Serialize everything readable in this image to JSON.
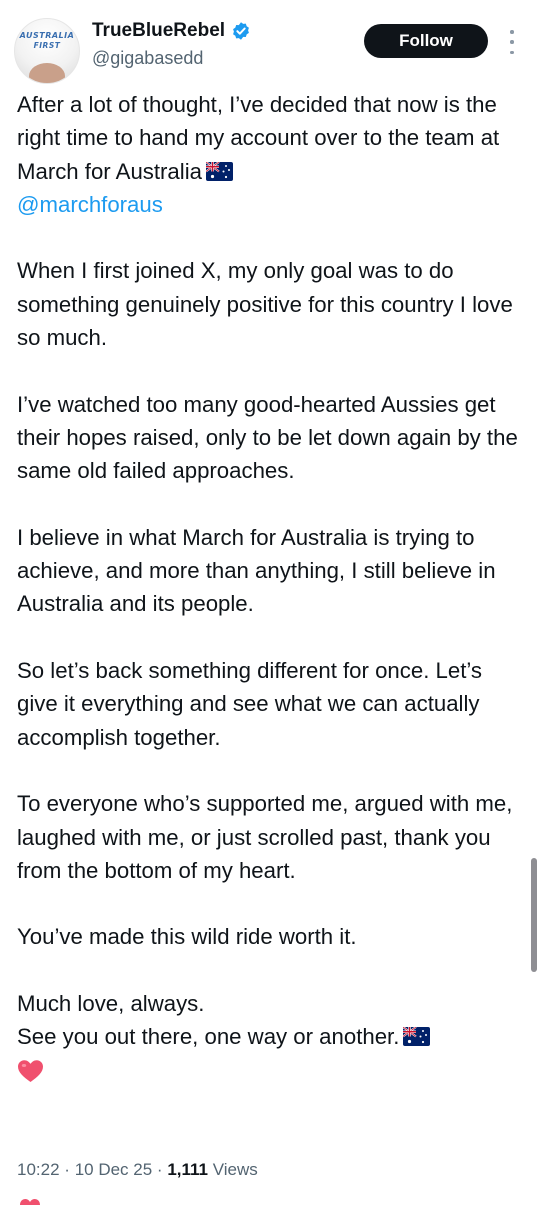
{
  "post": {
    "author": {
      "display_name": "TrueBlueRebel",
      "handle": "@gigabasedd",
      "avatar_cap_text": [
        "AUSTRALIA",
        "FIRST"
      ],
      "verified": true
    },
    "follow_label": "Follow",
    "mention": "@marchforaus",
    "paragraphs": {
      "p1": "After a lot of thought, I’ve decided that now is the right time to hand my account over to the team at March for Australia",
      "p2": "When I first joined X, my only goal was to do something genuinely positive for this country I love so much.",
      "p3": "I’ve watched too many good-hearted Aussies get their hopes raised, only to be let down again by the same old failed approaches.",
      "p4": "I believe in what March for Australia is trying to achieve, and more than anything, I still believe in Australia and its people.",
      "p5": "So let’s back something different for once. Let’s give it everything and see what we can actually accomplish together.",
      "p6": "To everyone who’s supported me, argued with me, laughed with me, or just scrolled past, thank you from the bottom of my heart.",
      "p7": "You’ve made this wild ride worth it.",
      "p8a": "Much love, always.",
      "p8b": "See you out there, one way or another."
    },
    "meta": {
      "time": "10:22",
      "date": "10 Dec 25",
      "views_count": "1,111",
      "views_label": "Views"
    }
  },
  "icons": {
    "verified": "verified-badge-icon",
    "flag": "australian-flag-emoji",
    "heart": "pink-heart-emoji",
    "more": "more-options-icon"
  },
  "colors": {
    "link": "#1d9bf0",
    "verified": "#1d9bf0",
    "muted": "#536471",
    "follow_bg": "#0f1419",
    "heart": "#f0506e"
  }
}
